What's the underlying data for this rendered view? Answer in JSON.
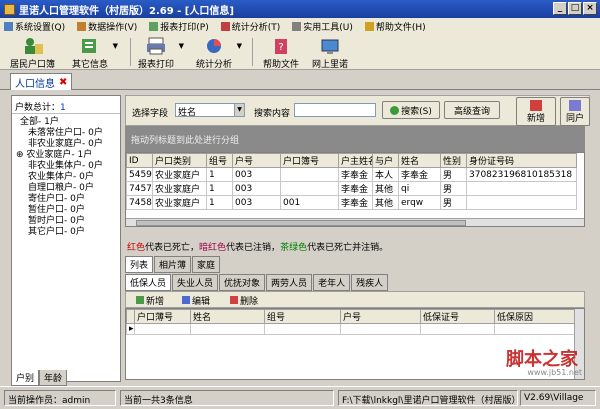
{
  "window": {
    "title": "里诺人口管理软件（村居版）2.69 - [人口信息]"
  },
  "menu": [
    {
      "label": "系统设置(Q)"
    },
    {
      "label": "数据操作(V)"
    },
    {
      "label": "报表打印(P)"
    },
    {
      "label": "统计分析(T)"
    },
    {
      "label": "实用工具(U)"
    },
    {
      "label": "帮助文件(H)"
    }
  ],
  "toolbar": {
    "resident_book": "居民户口簿",
    "other_info": "其它信息",
    "report_print": "报表打印",
    "stat_analysis": "统计分析",
    "help_file": "帮助文件",
    "online_lino": "网上里诺"
  },
  "doc_tab": {
    "label": "人口信息"
  },
  "left": {
    "total_label": "户数总计：",
    "total_value": "1",
    "tree": [
      "全部- 1户",
      "未落常住户口- 0户",
      "非农业家庭户- 0户",
      "农业家庭户- 1户",
      "非农业集体户- 0户",
      "农业集体户- 0户",
      "自理口粮户- 0户",
      "寄住户口- 0户",
      "暂住户口- 0户",
      "暂时户口- 0户",
      "其它户口- 0户"
    ],
    "tabs": [
      "户别",
      "年龄"
    ]
  },
  "search": {
    "field_label": "选择字段",
    "field_value": "姓名",
    "content_label": "搜索内容",
    "content_value": "",
    "search_btn": "搜索(S)",
    "advanced_btn": "高级查询",
    "add_btn": "新增",
    "next_btn": "同户"
  },
  "group_hint": "拖动列标题到此处进行分组",
  "grid": {
    "columns": [
      "ID",
      "户口类别",
      "组号",
      "户号",
      "户口簿号",
      "户主姓名",
      "与户",
      "姓名",
      "性别",
      "身份证号码"
    ],
    "rows": [
      [
        "5459",
        "农业家庭户",
        "1",
        "003",
        "",
        "李奉金",
        "本人",
        "李奉金",
        "男",
        "370823196810185318"
      ],
      [
        "7457",
        "农业家庭户",
        "1",
        "003",
        "",
        "李奉金",
        "其他",
        "qi",
        "男",
        ""
      ],
      [
        "7458",
        "农业家庭户",
        "1",
        "003",
        "001",
        "李奉金",
        "其他",
        "erqw",
        "男",
        ""
      ]
    ]
  },
  "legend": {
    "red": "红色",
    "red_text": "代表已死亡，",
    "dark": "暗红色",
    "dark_text": "代表已注销，",
    "green": "茶绿色",
    "green_text": "代表已死亡并注销。"
  },
  "subtabs_top": [
    "列表",
    "相片薄",
    "家庭"
  ],
  "subtabs_bottom": [
    "低保人员",
    "失业人员",
    "优抚对象",
    "两劳人员",
    "老年人",
    "残疾人"
  ],
  "lower_toolbar": {
    "add": "新增",
    "edit": "编辑",
    "delete": "删除"
  },
  "lower_grid": {
    "columns": [
      "户口薄号",
      "姓名",
      "组号",
      "户号",
      "低保证号",
      "低保原因"
    ]
  },
  "status": {
    "operator": "当前操作员：admin",
    "count": "当前一共3条信息",
    "path": "F:\\下载\\lnkkgl\\里诺户口管理软件（村居版）",
    "version": "V2.69\\Village"
  },
  "watermark": {
    "main": "脚本之家",
    "sub": "www.jb51.net"
  },
  "colors": {
    "title": "#1a3f9e",
    "red": "#cc0000",
    "darkred": "#a0004a",
    "green": "#008000"
  }
}
